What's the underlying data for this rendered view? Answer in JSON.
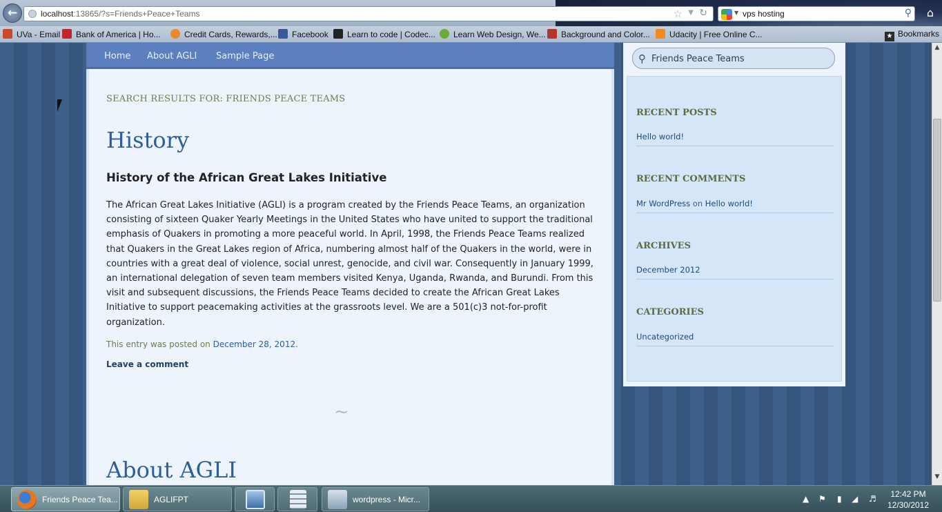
{
  "browser": {
    "url_host": "localhost",
    "url_rest": ":13865/?s=Friends+Peace+Teams",
    "search_value": "vps hosting",
    "bookmarks": [
      {
        "label": "UVa - Email",
        "color": "#c94b2c"
      },
      {
        "label": "Bank of America | Ho...",
        "color": "#c0272d"
      },
      {
        "label": "Credit Cards, Rewards,...",
        "color": "#e8892f"
      },
      {
        "label": "Facebook",
        "color": "#3b5998"
      },
      {
        "label": "Learn to code | Codec...",
        "color": "#222222"
      },
      {
        "label": "Learn Web Design, We...",
        "color": "#6aab3a"
      },
      {
        "label": "Background and Color...",
        "color": "#b3372e"
      },
      {
        "label": "Udacity | Free Online C...",
        "color": "#f28c20"
      }
    ],
    "bookmarks_menu": "Bookmarks"
  },
  "nav": {
    "items": [
      "Home",
      "About AGLI",
      "Sample Page"
    ]
  },
  "main": {
    "search_heading": "SEARCH RESULTS FOR: FRIENDS PEACE TEAMS",
    "post_title": "History",
    "post_subtitle": "History of the African Great Lakes Initiative",
    "post_body": "The African Great Lakes Initiative (AGLI) is a program created by the Friends Peace Teams, an organization consisting of sixteen Quaker Yearly Meetings in the United States who have united to support the traditional emphasis of Quakers in promoting a more peaceful world. In April, 1998, the Friends Peace Teams realized that Quakers in the Great Lakes region of Africa, numbering almost half of the Quakers in the world, were in countries with a great deal of violence, social unrest, genocide, and civil war. Consequently in January 1999, an international delegation of seven team members visited Kenya, Uganda, Rwanda, and Burundi. From this visit and subsequent discussions, the Friends Peace Teams decided to create the African Great Lakes Initiative to support peacemaking activities at the grassroots level. We are a 501(c)3 not-for-profit organization.",
    "post_meta_prefix": "This entry was posted on ",
    "post_meta_date": "December 28, 2012",
    "post_meta_suffix": ".",
    "leave_comment": "Leave a comment",
    "ornament": "~",
    "next_post_title": "About AGLI"
  },
  "sidebar": {
    "search_value": "Friends Peace Teams",
    "recent_posts_title": "RECENT POSTS",
    "recent_posts": [
      "Hello world!"
    ],
    "recent_comments_title": "RECENT COMMENTS",
    "recent_comment_author": "Mr WordPress",
    "recent_comment_on": " on ",
    "recent_comment_post": "Hello world!",
    "archives_title": "ARCHIVES",
    "archives": [
      "December 2012"
    ],
    "categories_title": "CATEGORIES",
    "categories": [
      "Uncategorized"
    ]
  },
  "taskbar": {
    "tasks": [
      {
        "label": "Friends Peace Tea...",
        "active": true
      },
      {
        "label": "AGLIFPT",
        "active": false
      },
      {
        "label": "wordpress - Micr...",
        "active": false
      }
    ],
    "time": "12:42 PM",
    "date": "12/30/2012"
  }
}
